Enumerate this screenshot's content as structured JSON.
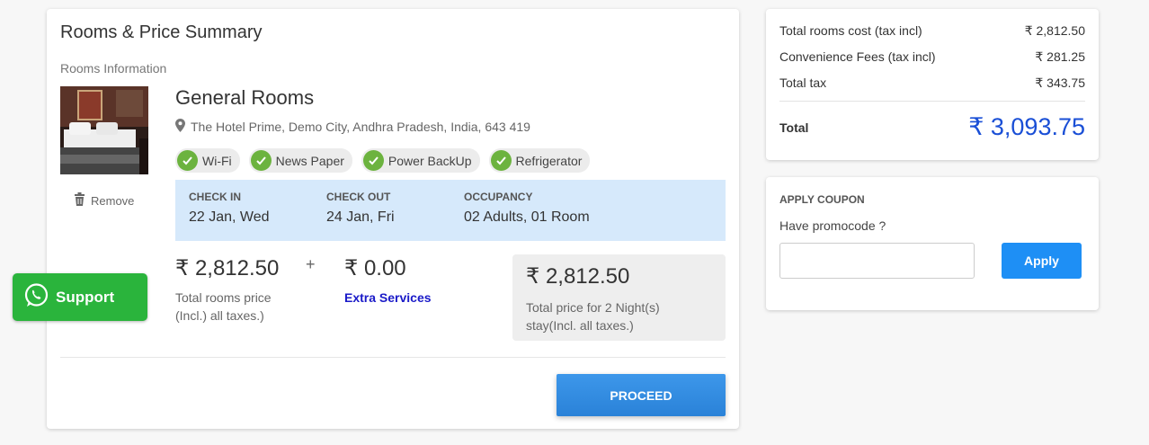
{
  "main": {
    "title": "Rooms & Price Summary",
    "rooms_info_label": "Rooms Information",
    "remove_label": "Remove",
    "room_name": "General Rooms",
    "address": "The Hotel Prime, Demo City, Andhra Pradesh, India, 643 419",
    "amenities": [
      "Wi-Fi",
      "News Paper",
      "Power BackUp",
      "Refrigerator"
    ],
    "stay": {
      "check_in_label": "CHECK IN",
      "check_in_value": "22 Jan, Wed",
      "check_out_label": "CHECK OUT",
      "check_out_value": "24 Jan, Fri",
      "occupancy_label": "OCCUPANCY",
      "occupancy_value": "02 Adults, 01 Room"
    },
    "rooms_price": "₹ 2,812.50",
    "rooms_price_note_line1": "Total rooms price",
    "rooms_price_note_line2": "(Incl.) all taxes.)",
    "plus": "+",
    "extra_price": "₹ 0.00",
    "extra_services_label": "Extra Services",
    "total_price": "₹ 2,812.50",
    "total_price_note_line1": "Total price for 2 Night(s)",
    "total_price_note_line2": "stay(Incl. all taxes.)",
    "proceed_label": "PROCEED"
  },
  "support": {
    "label": "Support",
    "color": "#2ab43c"
  },
  "summary": {
    "rows": [
      {
        "label": "Total rooms cost (tax incl)",
        "value": "₹ 2,812.50"
      },
      {
        "label": "Convenience Fees (tax incl)",
        "value": "₹ 281.25"
      },
      {
        "label": "Total tax",
        "value": "₹ 343.75"
      }
    ],
    "total_label": "Total",
    "total_value": "₹ 3,093.75",
    "total_color": "#1a4fd6"
  },
  "coupon": {
    "title": "APPLY COUPON",
    "prompt": "Have promocode ?",
    "input_value": "",
    "input_placeholder": "",
    "apply_label": "Apply"
  },
  "colors": {
    "accent_blue": "#1e8ff5",
    "stay_bg": "#d6e9fb",
    "check_green": "#6cb33f",
    "link_blue": "#1a1ac8"
  },
  "icons": {
    "remove": "trash-icon",
    "address": "map-marker-icon",
    "amenity": "check-circle-icon",
    "support": "whatsapp-icon"
  }
}
